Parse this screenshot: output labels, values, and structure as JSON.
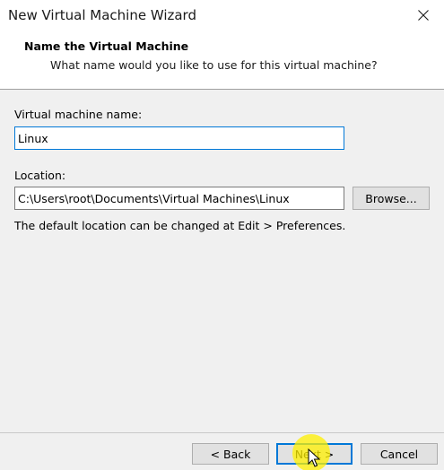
{
  "window": {
    "title": "New Virtual Machine Wizard"
  },
  "header": {
    "title": "Name the Virtual Machine",
    "subtitle": "What name would you like to use for this virtual machine?"
  },
  "form": {
    "vm_name_label": "Virtual machine name:",
    "vm_name_value": "Linux",
    "location_label": "Location:",
    "location_value": "C:\\Users\\root\\Documents\\Virtual Machines\\Linux",
    "browse_label": "Browse...",
    "hint": "The default location can be changed at Edit > Preferences."
  },
  "footer": {
    "back_label": "< Back",
    "next_label": "Next >",
    "cancel_label": "Cancel"
  },
  "colors": {
    "accent": "#0078d7",
    "panel_bg": "#f0f0f0",
    "cursor_highlight": "#fff000"
  },
  "icons": {
    "close": "close-icon",
    "cursor": "mouse-pointer-icon"
  }
}
